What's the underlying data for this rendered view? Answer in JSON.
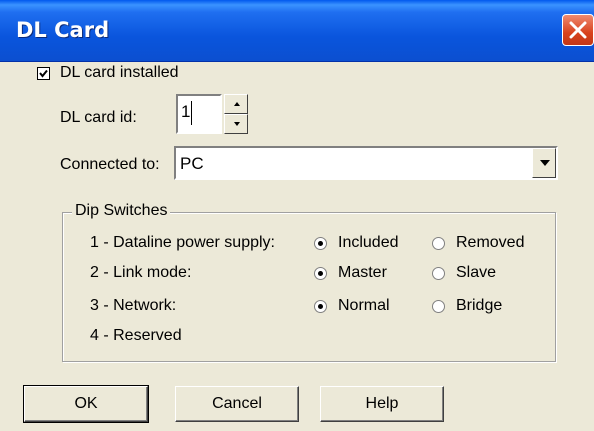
{
  "window": {
    "title": "DL Card"
  },
  "installed": {
    "label": "DL card installed",
    "checked": true
  },
  "card_id": {
    "label": "DL card id:",
    "value": "1"
  },
  "connected": {
    "label": "Connected to:",
    "value": "PC"
  },
  "dip": {
    "title": "Dip Switches",
    "rows": [
      {
        "label": "1 - Dataline power supply:",
        "opt1": "Included",
        "opt2": "Removed",
        "selected": "opt1"
      },
      {
        "label": "2 - Link mode:",
        "opt1": "Master",
        "opt2": "Slave",
        "selected": "opt1"
      },
      {
        "label": "3 - Network:",
        "opt1": "Normal",
        "opt2": "Bridge",
        "selected": "opt1"
      },
      {
        "label": "4 - Reserved"
      }
    ]
  },
  "buttons": {
    "ok": "OK",
    "cancel": "Cancel",
    "help": "Help"
  }
}
